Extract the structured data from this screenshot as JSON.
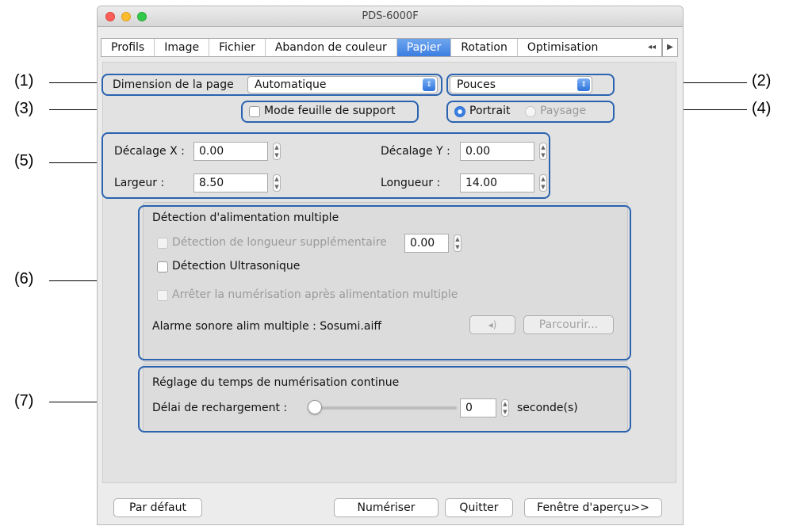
{
  "window": {
    "title": "PDS-6000F"
  },
  "tabs": [
    {
      "label": "Profils",
      "active": false
    },
    {
      "label": "Image",
      "active": false
    },
    {
      "label": "Fichier",
      "active": false
    },
    {
      "label": "Abandon de couleur",
      "active": false
    },
    {
      "label": "Papier",
      "active": true
    },
    {
      "label": "Rotation",
      "active": false
    },
    {
      "label": "Optimisation",
      "active": false
    }
  ],
  "tab_scroll": {
    "left": "◂◂",
    "right": "▶"
  },
  "page_size": {
    "label": "Dimension de la page",
    "value": "Automatique"
  },
  "units": {
    "value": "Pouces"
  },
  "carrier_mode": {
    "label": "Mode feuille de support",
    "checked": false
  },
  "orientation": {
    "portrait": "Portrait",
    "landscape": "Paysage",
    "selected": "Portrait"
  },
  "offset": {
    "x_label": "Décalage X :",
    "x_value": "0.00",
    "y_label": "Décalage Y :",
    "y_value": "0.00",
    "width_label": "Largeur :",
    "width_value": "8.50",
    "length_label": "Longueur :",
    "length_value": "14.00"
  },
  "multifeed": {
    "title": "Détection d'alimentation multiple",
    "length_label": "Détection de longueur supplémentaire",
    "length_value": "0.00",
    "ultrasonic_label": "Détection Ultrasonique",
    "stop_label": "Arrêter la numérisation après alimentation multiple",
    "alarm_label": "Alarme sonore alim multiple : Sosumi.aiff",
    "play_icon": "speaker-icon",
    "browse_label": "Parcourir..."
  },
  "continuous": {
    "title": "Réglage du temps de numérisation continue",
    "delay_label": "Délai de rechargement :",
    "delay_value": "0",
    "unit": "seconde(s)",
    "slider_fraction": 0
  },
  "buttons": {
    "default": "Par défaut",
    "scan": "Numériser",
    "quit": "Quitter",
    "preview": "Fenêtre d'aperçu>>"
  },
  "callouts": [
    "(1)",
    "(2)",
    "(3)",
    "(4)",
    "(5)",
    "(6)",
    "(7)"
  ],
  "colors": {
    "accent": "#3b7ee1",
    "callout": "#2a63b0",
    "close": "#fc5f57",
    "minimize": "#fdbc2e",
    "zoom": "#34c84a"
  }
}
